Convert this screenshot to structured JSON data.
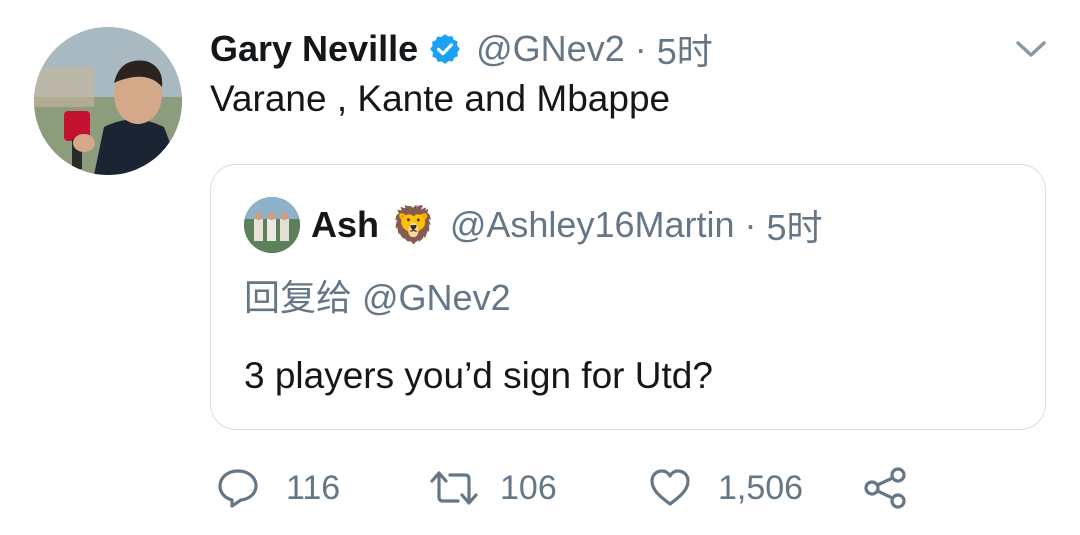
{
  "tweet": {
    "author_name": "Gary Neville",
    "author_handle": "@GNev2",
    "separator": "·",
    "time": "5时",
    "text": "Varane , Kante and Mbappe",
    "verified": true
  },
  "quoted_tweet": {
    "author_name": "Ash",
    "author_emoji": "🦁",
    "author_handle": "@Ashley16Martin",
    "separator": "·",
    "time": "5时",
    "reply_to": "回复给 @GNev2",
    "text": "3 players you’d sign for Utd?"
  },
  "actions": {
    "reply_count": "116",
    "retweet_count": "106",
    "like_count": "1,506"
  },
  "colors": {
    "primary_text": "#14171a",
    "secondary_text": "#657786",
    "verified_blue": "#1da1f2",
    "border": "#d8dee3"
  },
  "icons": {
    "verified": "verified-badge-icon",
    "menu": "chevron-down-icon",
    "reply": "reply-icon",
    "retweet": "retweet-icon",
    "like": "heart-icon",
    "share": "share-icon"
  }
}
